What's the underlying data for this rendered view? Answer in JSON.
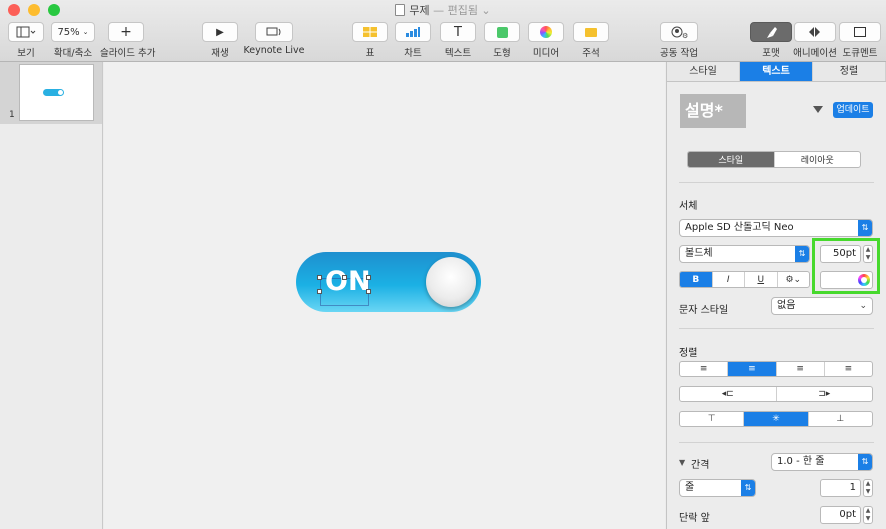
{
  "window": {
    "title": "무제",
    "status": "— 편집됨 ⌄"
  },
  "toolbar": {
    "view": {
      "label": "보기",
      "icon": "sidebar-icon"
    },
    "zoom": {
      "label": "확대/축소",
      "value": "75%"
    },
    "add_slide": {
      "label": "슬라이드 추가",
      "glyph": "+"
    },
    "play": {
      "label": "재생",
      "glyph": "▶"
    },
    "keynote_live": {
      "label": "Keynote Live"
    },
    "table": {
      "label": "표"
    },
    "chart": {
      "label": "차트"
    },
    "text": {
      "label": "텍스트",
      "glyph": "T"
    },
    "shape": {
      "label": "도형"
    },
    "media": {
      "label": "미디어"
    },
    "comment": {
      "label": "주석"
    },
    "collaborate": {
      "label": "공동 작업"
    },
    "format": {
      "label": "포맷"
    },
    "animate": {
      "label": "애니메이션"
    },
    "document": {
      "label": "도큐멘트"
    }
  },
  "navigator": {
    "slide_number": "1"
  },
  "slide": {
    "toggle_text": "ON"
  },
  "inspector": {
    "tabs": [
      "스타일",
      "텍스트",
      "정렬"
    ],
    "paragraph_style": "설명*",
    "update_button": "업데이트",
    "subtabs": [
      "스타일",
      "레이아웃"
    ],
    "font_section": "서체",
    "font_family": "Apple SD 산돌고딕 Neo",
    "font_weight": "볼드체",
    "font_size": "50pt",
    "style_buttons": {
      "bold": "B",
      "italic": "I",
      "underline": "U",
      "gear": "⚙⌄"
    },
    "char_style_label": "문자 스타일",
    "char_style_value": "없음",
    "align_section": "정렬",
    "spacing_label": "간격",
    "spacing_value": "1.0 - 한 줄",
    "spacing_unit": "줄",
    "spacing_number": "1",
    "before_para_label": "단락 앞",
    "before_para_value": "0pt"
  },
  "colors": {
    "accent": "#1b7fe6",
    "highlight": "#47d92d",
    "toggle": "#1bb0e4"
  }
}
